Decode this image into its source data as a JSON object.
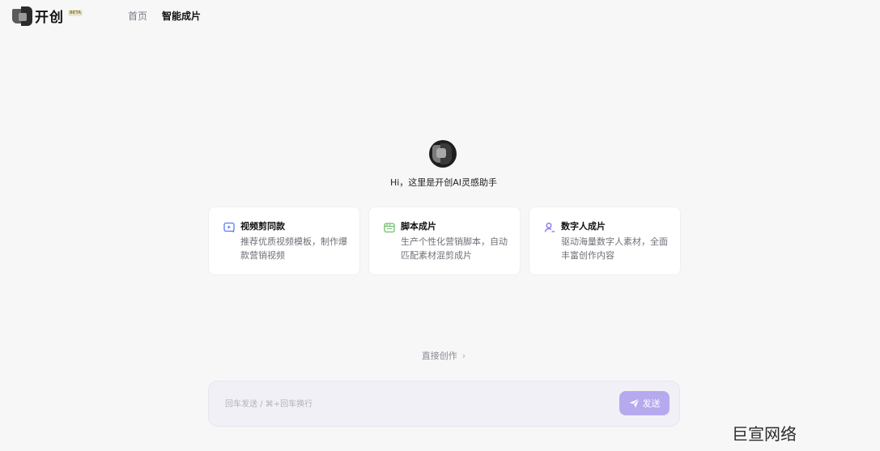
{
  "app": {
    "brand_name": "开创",
    "beta_badge": "BETA"
  },
  "nav": {
    "home": "首页",
    "smart_video": "智能成片"
  },
  "hero": {
    "greeting": "Hi，这里是开创AI灵感助手"
  },
  "cards": [
    {
      "title": "视频剪同款",
      "desc": "推荐优质视频模板，制作爆款营销视频",
      "icon": "video-template-icon",
      "color": "#5b7cf0"
    },
    {
      "title": "脚本成片",
      "desc": "生产个性化营销脚本，自动匹配素材混剪成片",
      "icon": "clapperboard-icon",
      "color": "#6cc06a"
    },
    {
      "title": "数字人成片",
      "desc": "驱动海量数字人素材，全面丰富创作内容",
      "icon": "person-icon",
      "color": "#8b6df0"
    }
  ],
  "direct_create": {
    "label": "直接创作",
    "chevron": "›"
  },
  "composer": {
    "placeholder": "回车发送 / ⌘+回车换行",
    "value": "",
    "send_label": "发送",
    "send_color": "#b7a9ee"
  },
  "watermark": "巨宣网络"
}
